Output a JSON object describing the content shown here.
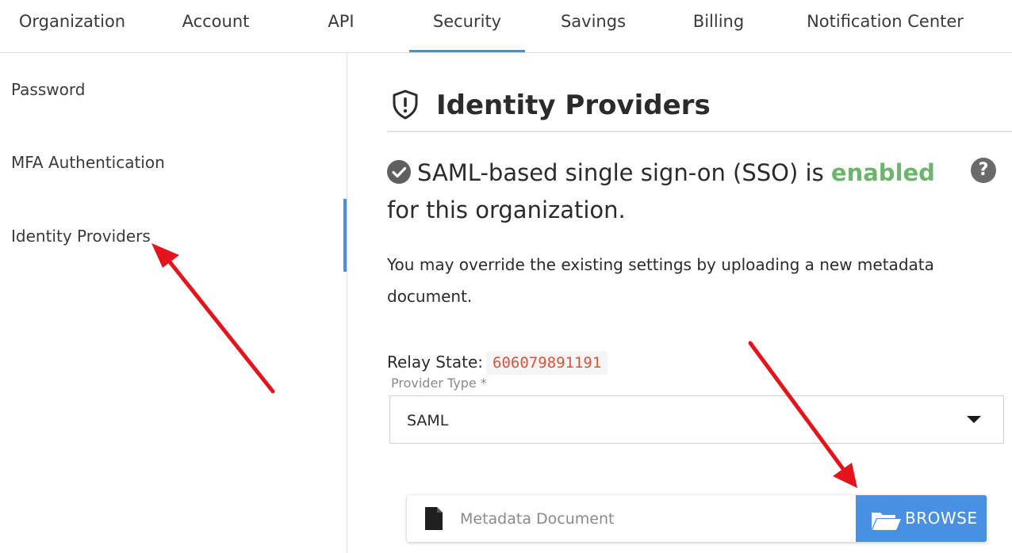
{
  "tabs": [
    {
      "label": "Organization"
    },
    {
      "label": "Account"
    },
    {
      "label": "API"
    },
    {
      "label": "Security"
    },
    {
      "label": "Savings"
    },
    {
      "label": "Billing"
    },
    {
      "label": "Notification Center"
    }
  ],
  "active_tab": "Security",
  "sidebar": {
    "items": [
      {
        "label": "Password"
      },
      {
        "label": "MFA Authentication"
      },
      {
        "label": "Identity Providers"
      }
    ],
    "active_item": "Identity Providers"
  },
  "main": {
    "heading": "Identity Providers",
    "heading_icon": "shield-alert-icon",
    "status": {
      "prefix": "SAML-based single sign-on (SSO) is ",
      "state": "enabled",
      "suffix": " for this organization.",
      "icon": "check-circle-icon"
    },
    "help_icon": "?",
    "description": "You may override the existing settings by uploading a new metadata document.",
    "relay_state": {
      "label": "Relay State:",
      "value": "606079891191"
    },
    "provider_type": {
      "label": "Provider Type *",
      "value": "SAML"
    },
    "metadata": {
      "placeholder": "Metadata Document",
      "browse_label": "BROWSE"
    }
  },
  "colors": {
    "accent": "#4a90e2",
    "enabled": "#6db56d",
    "code": "#d9543b",
    "annotation_arrow": "#e3141b"
  }
}
